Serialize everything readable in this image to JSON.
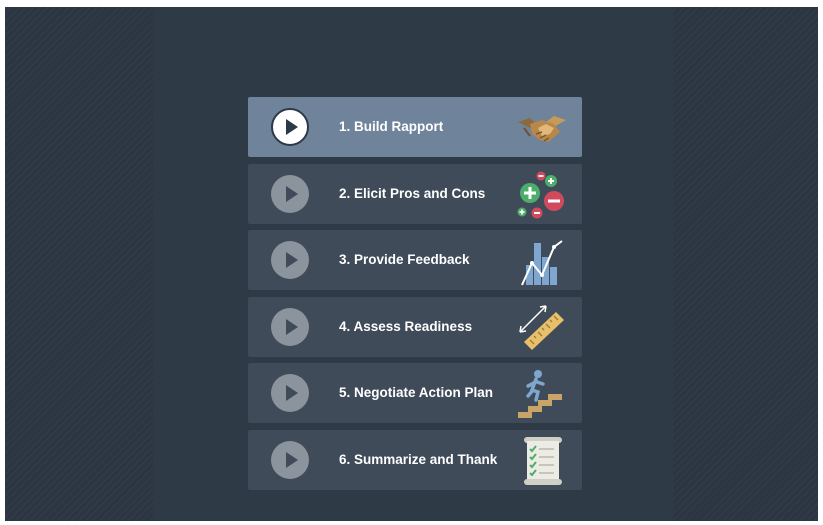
{
  "menu": {
    "items": [
      {
        "label": "1. Build Rapport",
        "icon": "handshake-icon",
        "active": true
      },
      {
        "label": "2. Elicit Pros and Cons",
        "icon": "plus-minus-icon",
        "active": false
      },
      {
        "label": "3. Provide Feedback",
        "icon": "bar-line-chart-icon",
        "active": false
      },
      {
        "label": "4. Assess Readiness",
        "icon": "ruler-measure-icon",
        "active": false
      },
      {
        "label": "5. Negotiate Action Plan",
        "icon": "climbing-stairs-icon",
        "active": false
      },
      {
        "label": "6. Summarize and Thank",
        "icon": "checklist-scroll-icon",
        "active": false
      }
    ]
  },
  "colors": {
    "background": "#2b3642",
    "panel": "#2f3a47",
    "item": "#3f4b59",
    "item_active": "#6f849b",
    "text": "#ffffff"
  }
}
